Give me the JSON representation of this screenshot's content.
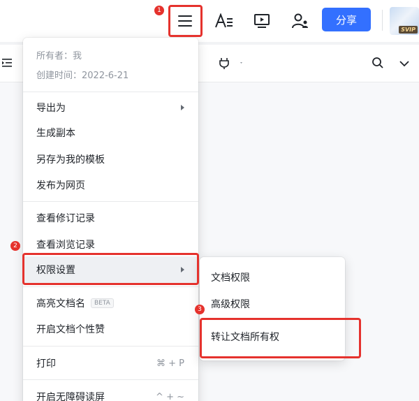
{
  "header": {
    "share_label": "分享",
    "vip_badge": "SVIP",
    "icons": [
      "menu-icon",
      "text-format-icon",
      "present-icon",
      "collaborators-icon"
    ]
  },
  "subtoolbar": {
    "icons": [
      "indent-icon",
      "plugin-icon",
      "search-icon",
      "chevron-down-icon"
    ]
  },
  "menu": {
    "owner": "所有者：我",
    "created": "创建时间：2022-6-21",
    "export_as": "导出为",
    "make_copy": "生成副本",
    "save_as_template": "另存为我的模板",
    "publish_web": "发布为网页",
    "revision_history": "查看修订记录",
    "view_history": "查看浏览记录",
    "permissions": "权限设置",
    "highlight_name": "高亮文档名",
    "beta": "BETA",
    "doc_likes": "开启文档个性赞",
    "print": "打印",
    "print_shortcut": "⌘ + P",
    "accessibility": "开启无障碍读屏",
    "accessibility_shortcut": "^ + ~"
  },
  "submenu": {
    "doc_permissions": "文档权限",
    "advanced_permissions": "高级权限",
    "transfer_ownership": "转让文档所有权"
  },
  "annotations": {
    "step1": "1",
    "step2": "2",
    "step3": "3"
  },
  "colors": {
    "accent": "#3370ff",
    "annotation_red": "#e5322d"
  }
}
